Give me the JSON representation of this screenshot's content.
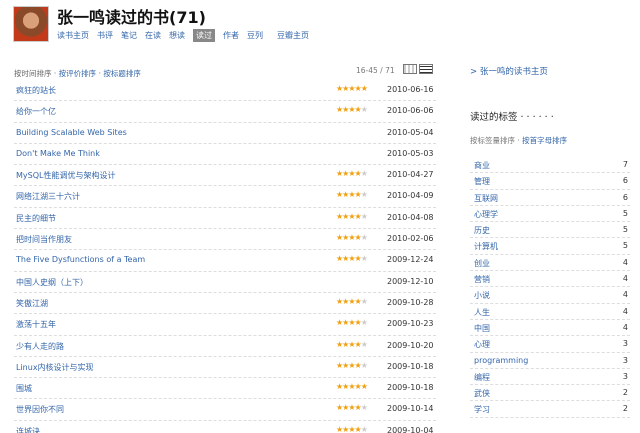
{
  "header": {
    "title": "张一鸣读过的书(71)",
    "nav": [
      {
        "label": "读书主页",
        "active": false
      },
      {
        "label": "书评",
        "active": false
      },
      {
        "label": "笔记",
        "active": false
      },
      {
        "label": "在读",
        "active": false
      },
      {
        "label": "想读",
        "active": false
      },
      {
        "label": "读过",
        "active": true
      },
      {
        "label": "作者",
        "active": false
      },
      {
        "label": "豆列",
        "active": false
      },
      {
        "label": "豆瓣主页",
        "active": false
      }
    ]
  },
  "sort": {
    "by_time": "按时间排序",
    "by_rating": "按评价排序",
    "by_title": "按标题排序",
    "separator": "·"
  },
  "pager": {
    "range": "16-45 / 71"
  },
  "books": [
    {
      "title": "疯狂的站长",
      "rating": 5,
      "date": "2010-06-16"
    },
    {
      "title": "给你一个亿",
      "rating": 4,
      "date": "2010-06-06"
    },
    {
      "title": "Building Scalable Web Sites",
      "rating": 0,
      "date": "2010-05-04"
    },
    {
      "title": "Don't Make Me Think",
      "rating": 0,
      "date": "2010-05-03"
    },
    {
      "title": "MySQL性能调优与架构设计",
      "rating": 4,
      "date": "2010-04-27"
    },
    {
      "title": "网络江湖三十六计",
      "rating": 4,
      "date": "2010-04-09"
    },
    {
      "title": "民主的细节",
      "rating": 4,
      "date": "2010-04-08"
    },
    {
      "title": "把时间当作朋友",
      "rating": 4,
      "date": "2010-02-06"
    },
    {
      "title": "The Five Dysfunctions of a Team",
      "rating": 4,
      "date": "2009-12-24"
    },
    {
      "title": "中国人史纲（上下）",
      "rating": 0,
      "date": "2009-12-10"
    },
    {
      "title": "笑傲江湖",
      "rating": 4,
      "date": "2009-10-28"
    },
    {
      "title": "激荡十五年",
      "rating": 4,
      "date": "2009-10-23"
    },
    {
      "title": "少有人走的路",
      "rating": 4,
      "date": "2009-10-20"
    },
    {
      "title": "Linux内核设计与实现",
      "rating": 4,
      "date": "2009-10-18"
    },
    {
      "title": "围城",
      "rating": 5,
      "date": "2009-10-18"
    },
    {
      "title": "世界因你不同",
      "rating": 4,
      "date": "2009-10-14"
    },
    {
      "title": "连城诀",
      "rating": 4,
      "date": "2009-10-04"
    }
  ],
  "sidebar": {
    "home_link": "> 张一鸣的读书主页",
    "tags_heading": "读过的标签 · · · · · ·",
    "tags_sort_by_count": "按标签量排序",
    "tags_sort_separator": " · ",
    "tags_sort_by_alpha": "按首字母排序",
    "tags": [
      {
        "name": "商业",
        "count": "7"
      },
      {
        "name": "管理",
        "count": "6"
      },
      {
        "name": "互联网",
        "count": "6"
      },
      {
        "name": "心理学",
        "count": "5"
      },
      {
        "name": "历史",
        "count": "5"
      },
      {
        "name": "计算机",
        "count": "5"
      },
      {
        "name": "创业",
        "count": "4"
      },
      {
        "name": "营销",
        "count": "4"
      },
      {
        "name": "小说",
        "count": "4"
      },
      {
        "name": "人生",
        "count": "4"
      },
      {
        "name": "中国",
        "count": "4"
      },
      {
        "name": "心理",
        "count": "3"
      },
      {
        "name": "programming",
        "count": "3"
      },
      {
        "name": "编程",
        "count": "3"
      },
      {
        "name": "武侠",
        "count": "2"
      },
      {
        "name": "学习",
        "count": "2"
      }
    ]
  },
  "colors": {
    "link": "#3366aa",
    "star": "#f0a010",
    "active_tab_bg": "#888888"
  }
}
